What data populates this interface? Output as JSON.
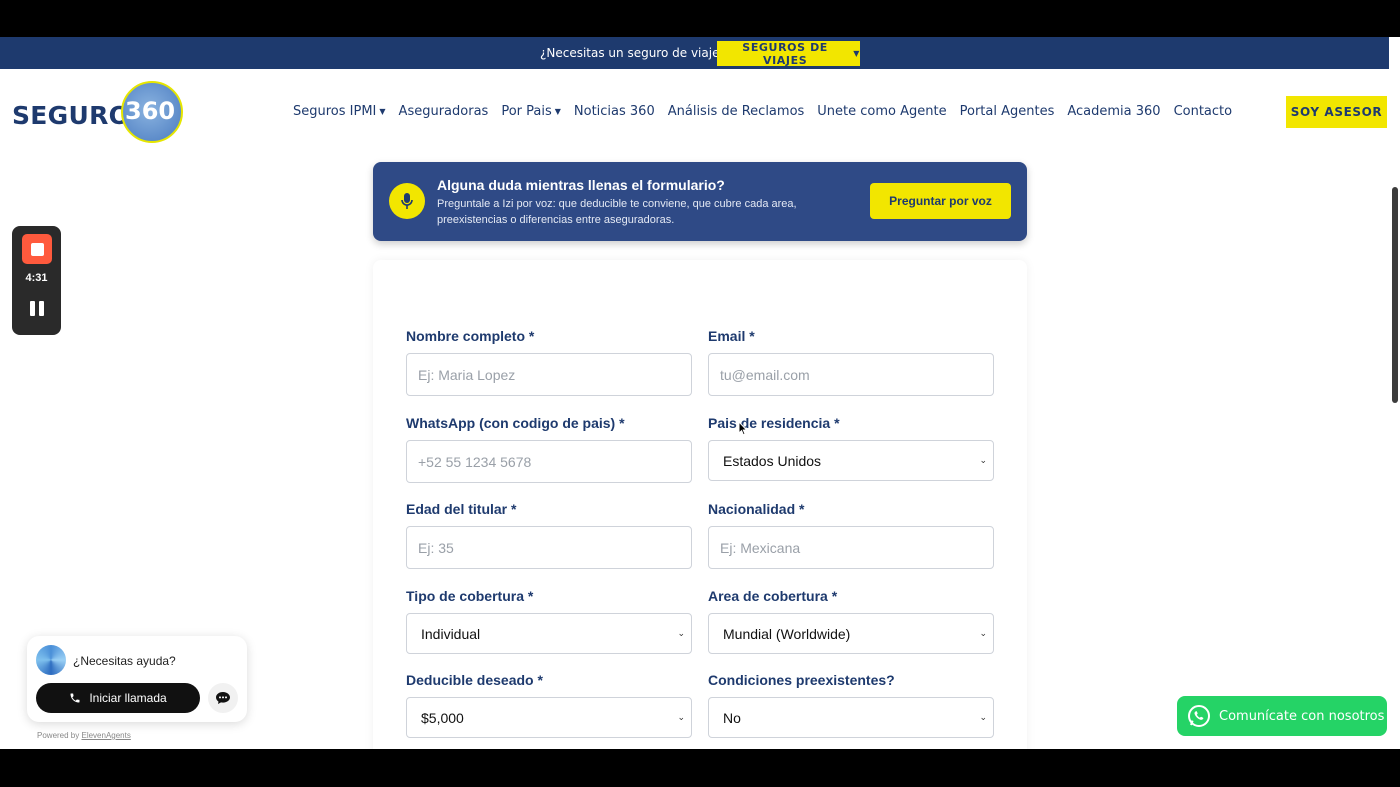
{
  "topbar": {
    "text": "¿Necesitas un seguro de viaje?",
    "button_label": "SEGUROS DE VIAJES"
  },
  "header": {
    "logo_text": "SEGUROS",
    "logo_number": "360",
    "nav": [
      {
        "label": "Seguros IPMI",
        "dropdown": true
      },
      {
        "label": "Aseguradoras",
        "dropdown": false
      },
      {
        "label": "Por Pais",
        "dropdown": true
      },
      {
        "label": "Noticias 360",
        "dropdown": false
      },
      {
        "label": "Análisis de Reclamos",
        "dropdown": false
      },
      {
        "label": "Unete como Agente",
        "dropdown": false
      },
      {
        "label": "Portal Agentes",
        "dropdown": false
      },
      {
        "label": "Academia 360",
        "dropdown": false
      },
      {
        "label": "Contacto",
        "dropdown": false
      }
    ],
    "cta_label": "SOY ASESOR"
  },
  "voice_banner": {
    "title": "Alguna duda mientras llenas el formulario?",
    "description": "Preguntale a Izi por voz: que deducible te conviene, que cubre cada area, preexistencias o diferencias entre aseguradoras.",
    "button_label": "Preguntar por voz"
  },
  "form": {
    "full_name": {
      "label": "Nombre completo *",
      "placeholder": "Ej: Maria Lopez"
    },
    "email": {
      "label": "Email *",
      "placeholder": "tu@email.com"
    },
    "whatsapp": {
      "label": "WhatsApp (con codigo de pais) *",
      "placeholder": "+52 55 1234 5678"
    },
    "country": {
      "label": "Pais de residencia *",
      "value": "Estados Unidos"
    },
    "age": {
      "label": "Edad del titular *",
      "placeholder": "Ej: 35"
    },
    "nationality": {
      "label": "Nacionalidad *",
      "placeholder": "Ej: Mexicana"
    },
    "coverage_type": {
      "label": "Tipo de cobertura *",
      "value": "Individual"
    },
    "coverage_area": {
      "label": "Area de cobertura *",
      "value": "Mundial (Worldwide)"
    },
    "deductible": {
      "label": "Deducible deseado *",
      "value": "$5,000"
    },
    "preexisting": {
      "label": "Condiciones preexistentes?",
      "value": "No"
    }
  },
  "recorder": {
    "time": "4:31"
  },
  "help_widget": {
    "text": "¿Necesitas ayuda?",
    "call_label": "Iniciar llamada",
    "powered_prefix": "Powered by",
    "powered_link": "ElevenAgents"
  },
  "whatsapp_button": {
    "label": "Comunícate con nosotros"
  },
  "colors": {
    "navy": "#1e3a6e",
    "yellow": "#f2e600",
    "banner_blue": "#2f4a86",
    "whatsapp_green": "#25d366",
    "record_red": "#ff5a3d"
  }
}
